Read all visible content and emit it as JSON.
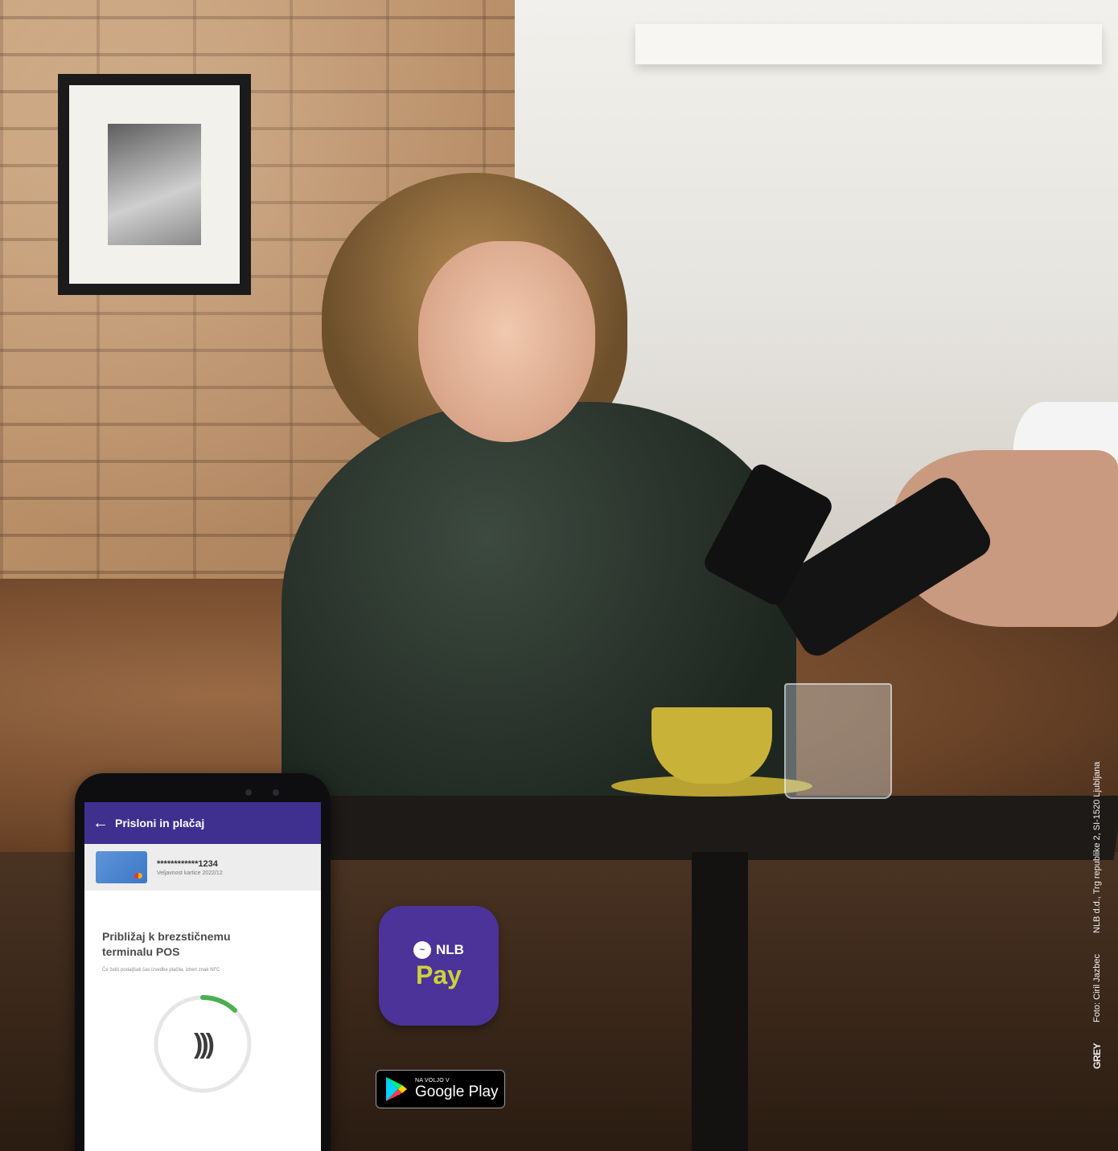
{
  "phone_app": {
    "title": "Prisloni in plačaj",
    "card_number": "************1234",
    "card_expiry": "Veljavnost kartice 2022/12",
    "heading_line1": "Približaj k brezstičnemu",
    "heading_line2": "terminalu POS",
    "hint": "Če želiš podaljšati čas izvedbe plačila, izberi znak NFC"
  },
  "app_badge": {
    "brand": "NLB",
    "product": "Pay"
  },
  "store_badge": {
    "small": "NA VOLJO V",
    "big": "Google Play"
  },
  "credits": {
    "agency": "GREY",
    "photo": "Foto: Ciril Jazbec",
    "address": "NLB d.d., Trg republike 2, SI-1520 Ljubljana"
  },
  "colors": {
    "appbar": "#3f2f8f",
    "badge": "#4b3399",
    "badge_accent": "#cdd23a",
    "progress": "#4caf50"
  }
}
